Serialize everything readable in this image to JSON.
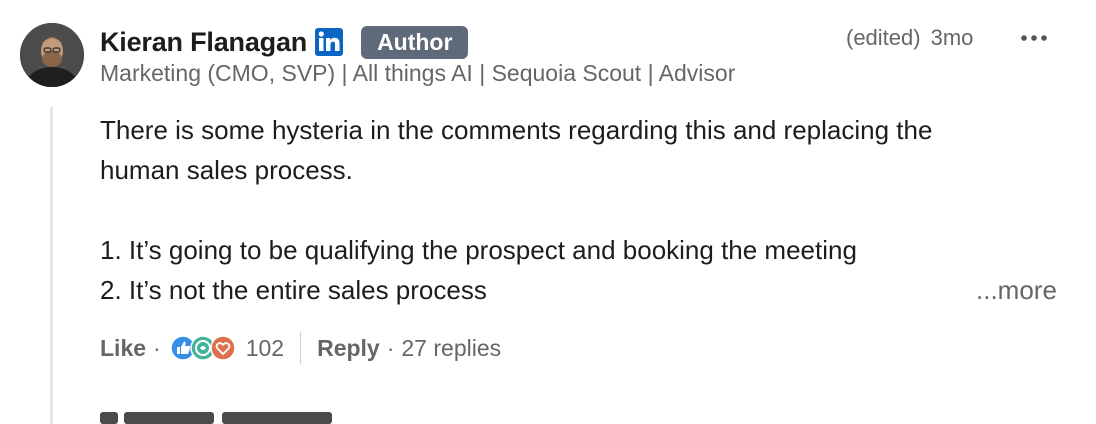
{
  "comment": {
    "author": {
      "name": "Kieran Flanagan",
      "badge": "Author",
      "headline": "Marketing (CMO, SVP) | All things AI | Sequoia Scout | Advisor",
      "avatar_icon": "person-avatar",
      "verified_icon": "linkedin-icon"
    },
    "meta": {
      "edited": "(edited)",
      "time": "3mo",
      "menu_icon": "more-horizontal-icon"
    },
    "body": {
      "line1": "There is some hysteria in the comments regarding this and replacing the",
      "line2": "human sales process.",
      "line3": "1. It’s going to be qualifying the prospect and booking the meeting",
      "line4": "2. It’s not the entire sales process",
      "see_more": "...more"
    },
    "actions": {
      "like": "Like",
      "separator": "·",
      "reaction_icons": [
        "like-reaction-icon",
        "celebrate-reaction-icon",
        "love-reaction-icon"
      ],
      "reaction_count": "102",
      "reply": "Reply",
      "replies": "27 replies"
    }
  },
  "colors": {
    "badge_bg": "#5e6a79",
    "linkedin_blue": "#0a66c2",
    "muted_text": "#666666",
    "thread_line": "#e8e6e1"
  }
}
